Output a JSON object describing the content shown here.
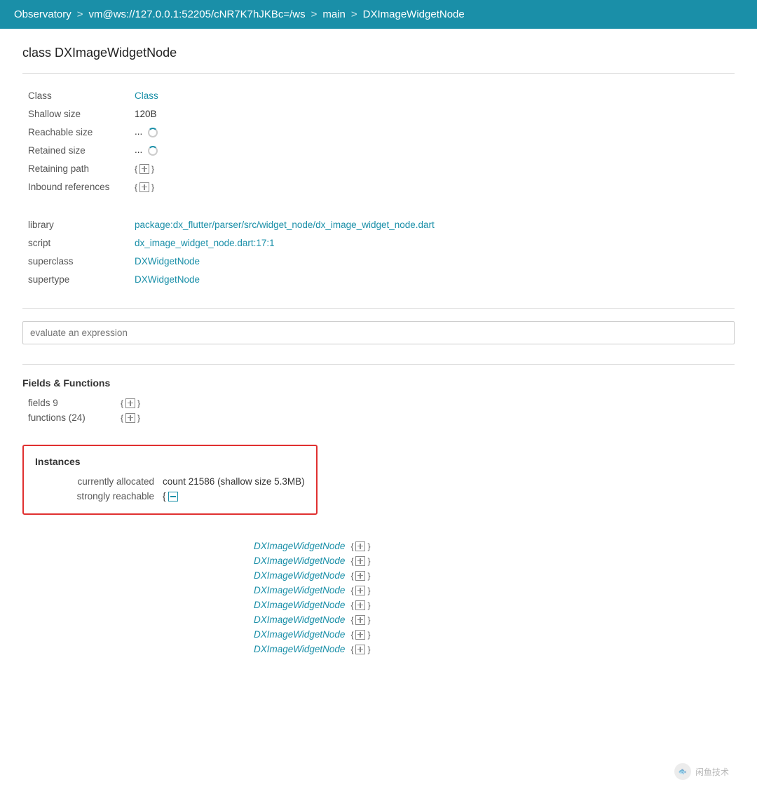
{
  "header": {
    "app_name": "Observatory",
    "sep1": ">",
    "vm_link": "vm@ws://127.0.0.1:52205/cNR7K7hJKBc=/ws",
    "sep2": ">",
    "main_link": "main",
    "sep3": ">",
    "current": "DXImageWidgetNode"
  },
  "page_title": "class DXImageWidgetNode",
  "info_section": {
    "rows": [
      {
        "label": "Class",
        "value": "Class",
        "type": "link"
      },
      {
        "label": "Shallow size",
        "value": "120B",
        "type": "text"
      },
      {
        "label": "Reachable size",
        "value": "...",
        "type": "loading"
      },
      {
        "label": "Retained size",
        "value": "...",
        "type": "loading"
      },
      {
        "label": "Retaining path",
        "value": "",
        "type": "expand"
      },
      {
        "label": "Inbound references",
        "value": "",
        "type": "expand"
      }
    ]
  },
  "info_section_2": {
    "rows": [
      {
        "label": "library",
        "value": "package:dx_flutter/parser/src/widget_node/dx_image_widget_node.dart",
        "type": "link"
      },
      {
        "label": "script",
        "value": "dx_image_widget_node.dart:17:1",
        "type": "link"
      },
      {
        "label": "superclass",
        "value": "DXWidgetNode",
        "type": "link"
      },
      {
        "label": "supertype",
        "value": "DXWidgetNode",
        "type": "link"
      }
    ]
  },
  "evaluate": {
    "placeholder": "evaluate an expression"
  },
  "fields_functions": {
    "title": "Fields & Functions",
    "rows": [
      {
        "label": "fields 9",
        "type": "expand"
      },
      {
        "label": "functions (24)",
        "type": "expand"
      }
    ]
  },
  "instances": {
    "title": "Instances",
    "currently_allocated_label": "currently allocated",
    "currently_allocated_value": "count 21586 (shallow size 5.3MB)",
    "strongly_reachable_label": "strongly reachable",
    "items": [
      "DXImageWidgetNode",
      "DXImageWidgetNode",
      "DXImageWidgetNode",
      "DXImageWidgetNode",
      "DXImageWidgetNode",
      "DXImageWidgetNode",
      "DXImageWidgetNode",
      "DXImageWidgetNode"
    ]
  },
  "watermark": {
    "icon": "🐟",
    "text": "闲鱼技术"
  }
}
